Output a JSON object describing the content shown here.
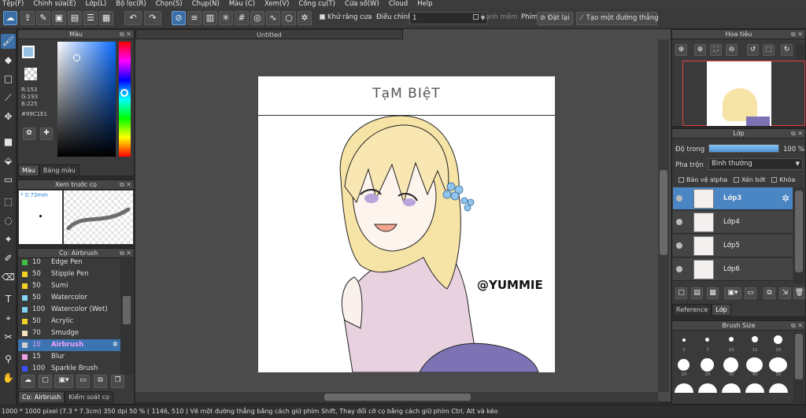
{
  "menu": [
    "Tệp(F)",
    "Chỉnh sửa(E)",
    "Lớp(L)",
    "Bộ lọc(R)",
    "Chọn(S)",
    "Chụp(N)",
    "Màu (C)",
    "Xem(V)",
    "Công cụ(T)",
    "Cửa sổ(W)",
    "Cloud",
    "Help"
  ],
  "toolbar": {
    "antialias_label": "Khử răng cưa",
    "adjust_label": "Điều chỉnh",
    "adjust_value": "1",
    "snap_label": "Cạnh mềm",
    "keys_label": "Phím",
    "reset_label": "Đặt lại",
    "new_line_label": "Tạo một đường thẳng"
  },
  "color_panel": {
    "title": "Màu",
    "r": "R:153",
    "g": "G:193",
    "b": "B:225",
    "hex": "#99C1E1",
    "tab_color": "Màu",
    "tab_palette": "Bảng màu",
    "current_color": "#99c1e1"
  },
  "preview_panel": {
    "title": "Xem trước cọ",
    "size": "0.73mm"
  },
  "brush_panel": {
    "title": "Cọ: Airbrush",
    "items": [
      {
        "num": "10",
        "name": "Edge Pen",
        "color": "#3fbf3f"
      },
      {
        "num": "50",
        "name": "Stipple Pen",
        "color": "#f2d024"
      },
      {
        "num": "50",
        "name": "Sumi",
        "color": "#f2d024"
      },
      {
        "num": "50",
        "name": "Watercolor",
        "color": "#7fd4f2"
      },
      {
        "num": "100",
        "name": "Watercolor (Wet)",
        "color": "#7fd4f2"
      },
      {
        "num": "50",
        "name": "Acrylic",
        "color": "#f2d024"
      },
      {
        "num": "70",
        "name": "Smudge",
        "color": "#f5e0c0"
      },
      {
        "num": "10",
        "name": "Airbrush",
        "color": "#d0d0d0"
      },
      {
        "num": "15",
        "name": "Blur",
        "color": "#f0a0e8"
      },
      {
        "num": "100",
        "name": "Sparkle Brush",
        "color": "#3850ff"
      }
    ],
    "tab_brush": "Cọ: Airbrush",
    "tab_control": "Kiểm soát cọ"
  },
  "document": {
    "tab_title": "Untitled",
    "heading": "TạM BIệT",
    "watermark": "@YUMMIE"
  },
  "navigator": {
    "title": "Hoa tiêu"
  },
  "layer_panel": {
    "title": "Lớp",
    "opacity_label": "Độ trong",
    "opacity_value": "100 %",
    "blend_label": "Pha trộn",
    "blend_value": "Bình thường",
    "protect_alpha": "Bảo vệ alpha",
    "clipping": "Xén bớt",
    "lock": "Khóa",
    "layers": [
      "Lớp3",
      "Lớp4",
      "Lớp5",
      "Lớp6"
    ],
    "tab_reference": "Reference",
    "tab_layer": "Lớp"
  },
  "brush_size_panel": {
    "title": "Brush Size",
    "sizes": [
      "3",
      "7",
      "10",
      "12",
      "15",
      "20",
      "25",
      "30",
      "40",
      "50"
    ]
  },
  "status": {
    "text": "1000 * 1000 pixel  (7.3 * 7.3cm)  350 dpi  50 %  ( 1146, 510 )  Vẽ một đường thẳng bằng cách giữ phím Shift, Thay đổi cỡ cọ bằng cách giữ phím Ctrl, Alt và kéo"
  }
}
